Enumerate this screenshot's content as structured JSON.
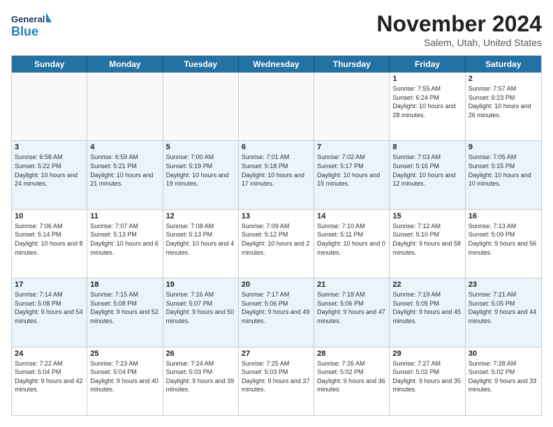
{
  "header": {
    "logo_general": "General",
    "logo_blue": "Blue",
    "month_title": "November 2024",
    "location": "Salem, Utah, United States"
  },
  "weekdays": [
    "Sunday",
    "Monday",
    "Tuesday",
    "Wednesday",
    "Thursday",
    "Friday",
    "Saturday"
  ],
  "rows": [
    [
      {
        "day": "",
        "text": ""
      },
      {
        "day": "",
        "text": ""
      },
      {
        "day": "",
        "text": ""
      },
      {
        "day": "",
        "text": ""
      },
      {
        "day": "",
        "text": ""
      },
      {
        "day": "1",
        "text": "Sunrise: 7:55 AM\nSunset: 6:24 PM\nDaylight: 10 hours and 28 minutes."
      },
      {
        "day": "2",
        "text": "Sunrise: 7:57 AM\nSunset: 6:23 PM\nDaylight: 10 hours and 26 minutes."
      }
    ],
    [
      {
        "day": "3",
        "text": "Sunrise: 6:58 AM\nSunset: 5:22 PM\nDaylight: 10 hours and 24 minutes."
      },
      {
        "day": "4",
        "text": "Sunrise: 6:59 AM\nSunset: 5:21 PM\nDaylight: 10 hours and 21 minutes."
      },
      {
        "day": "5",
        "text": "Sunrise: 7:00 AM\nSunset: 5:19 PM\nDaylight: 10 hours and 19 minutes."
      },
      {
        "day": "6",
        "text": "Sunrise: 7:01 AM\nSunset: 5:18 PM\nDaylight: 10 hours and 17 minutes."
      },
      {
        "day": "7",
        "text": "Sunrise: 7:02 AM\nSunset: 5:17 PM\nDaylight: 10 hours and 15 minutes."
      },
      {
        "day": "8",
        "text": "Sunrise: 7:03 AM\nSunset: 5:16 PM\nDaylight: 10 hours and 12 minutes."
      },
      {
        "day": "9",
        "text": "Sunrise: 7:05 AM\nSunset: 5:15 PM\nDaylight: 10 hours and 10 minutes."
      }
    ],
    [
      {
        "day": "10",
        "text": "Sunrise: 7:06 AM\nSunset: 5:14 PM\nDaylight: 10 hours and 8 minutes."
      },
      {
        "day": "11",
        "text": "Sunrise: 7:07 AM\nSunset: 5:13 PM\nDaylight: 10 hours and 6 minutes."
      },
      {
        "day": "12",
        "text": "Sunrise: 7:08 AM\nSunset: 5:13 PM\nDaylight: 10 hours and 4 minutes."
      },
      {
        "day": "13",
        "text": "Sunrise: 7:09 AM\nSunset: 5:12 PM\nDaylight: 10 hours and 2 minutes."
      },
      {
        "day": "14",
        "text": "Sunrise: 7:10 AM\nSunset: 5:11 PM\nDaylight: 10 hours and 0 minutes."
      },
      {
        "day": "15",
        "text": "Sunrise: 7:12 AM\nSunset: 5:10 PM\nDaylight: 9 hours and 58 minutes."
      },
      {
        "day": "16",
        "text": "Sunrise: 7:13 AM\nSunset: 5:09 PM\nDaylight: 9 hours and 56 minutes."
      }
    ],
    [
      {
        "day": "17",
        "text": "Sunrise: 7:14 AM\nSunset: 5:08 PM\nDaylight: 9 hours and 54 minutes."
      },
      {
        "day": "18",
        "text": "Sunrise: 7:15 AM\nSunset: 5:08 PM\nDaylight: 9 hours and 52 minutes."
      },
      {
        "day": "19",
        "text": "Sunrise: 7:16 AM\nSunset: 5:07 PM\nDaylight: 9 hours and 50 minutes."
      },
      {
        "day": "20",
        "text": "Sunrise: 7:17 AM\nSunset: 5:06 PM\nDaylight: 9 hours and 49 minutes."
      },
      {
        "day": "21",
        "text": "Sunrise: 7:18 AM\nSunset: 5:06 PM\nDaylight: 9 hours and 47 minutes."
      },
      {
        "day": "22",
        "text": "Sunrise: 7:19 AM\nSunset: 5:05 PM\nDaylight: 9 hours and 45 minutes."
      },
      {
        "day": "23",
        "text": "Sunrise: 7:21 AM\nSunset: 5:05 PM\nDaylight: 9 hours and 44 minutes."
      }
    ],
    [
      {
        "day": "24",
        "text": "Sunrise: 7:22 AM\nSunset: 5:04 PM\nDaylight: 9 hours and 42 minutes."
      },
      {
        "day": "25",
        "text": "Sunrise: 7:23 AM\nSunset: 5:04 PM\nDaylight: 9 hours and 40 minutes."
      },
      {
        "day": "26",
        "text": "Sunrise: 7:24 AM\nSunset: 5:03 PM\nDaylight: 9 hours and 39 minutes."
      },
      {
        "day": "27",
        "text": "Sunrise: 7:25 AM\nSunset: 5:03 PM\nDaylight: 9 hours and 37 minutes."
      },
      {
        "day": "28",
        "text": "Sunrise: 7:26 AM\nSunset: 5:02 PM\nDaylight: 9 hours and 36 minutes."
      },
      {
        "day": "29",
        "text": "Sunrise: 7:27 AM\nSunset: 5:02 PM\nDaylight: 9 hours and 35 minutes."
      },
      {
        "day": "30",
        "text": "Sunrise: 7:28 AM\nSunset: 5:02 PM\nDaylight: 9 hours and 33 minutes."
      }
    ]
  ]
}
